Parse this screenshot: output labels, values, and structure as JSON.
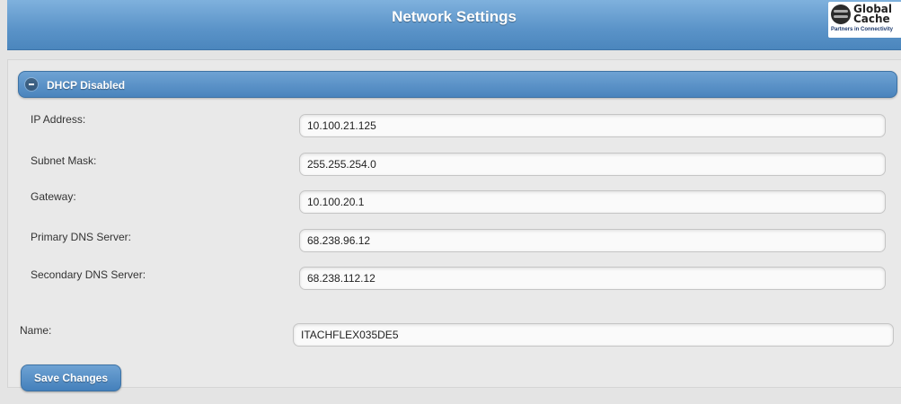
{
  "header": {
    "title": "Network Settings",
    "logo": {
      "line1": "Global",
      "line2": "Cache",
      "tagline": "Partners in Connectivity"
    }
  },
  "dhcp": {
    "label": "DHCP Disabled",
    "icon": "minus-circle-icon"
  },
  "fields": {
    "ip": {
      "label": "IP Address:",
      "value": "10.100.21.125"
    },
    "subnet": {
      "label": "Subnet Mask:",
      "value": "255.255.254.0"
    },
    "gateway": {
      "label": "Gateway:",
      "value": "10.100.20.1"
    },
    "primary_dns": {
      "label": "Primary DNS Server:",
      "value": "68.238.96.12"
    },
    "secondary_dns": {
      "label": "Secondary DNS Server:",
      "value": "68.238.112.12"
    },
    "name": {
      "label": "Name:",
      "value": "ITACHFLEX035DE5"
    }
  },
  "actions": {
    "save_label": "Save Changes"
  },
  "colors": {
    "accent": "#4a84bd",
    "background": "#e4e4e4"
  }
}
